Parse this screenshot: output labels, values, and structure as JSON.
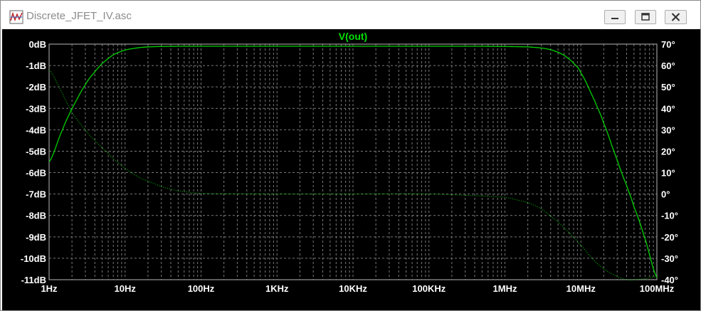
{
  "window": {
    "title": "Discrete_JFET_IV.asc",
    "app_icon": "ltspice-waveform-icon",
    "minimize_icon": "minimize-icon",
    "maximize_icon": "maximize-icon",
    "close_icon": "close-icon"
  },
  "chart_data": {
    "type": "line",
    "title": "V(out)",
    "xlabel": "",
    "ylabel": "",
    "x_scale": "log",
    "xlim": [
      1,
      100000000
    ],
    "x_ticks": [
      1,
      10,
      100,
      1000,
      10000,
      100000,
      1000000,
      10000000,
      100000000
    ],
    "x_tick_labels": [
      "1Hz",
      "10Hz",
      "100Hz",
      "1KHz",
      "10KHz",
      "100KHz",
      "1MHz",
      "10MHz",
      "100MHz"
    ],
    "ylim_left": [
      -11,
      0
    ],
    "y_left_ticks": [
      0,
      -1,
      -2,
      -3,
      -4,
      -5,
      -6,
      -7,
      -8,
      -9,
      -10,
      -11
    ],
    "y_left_tick_labels": [
      "0dB",
      "-1dB",
      "-2dB",
      "-3dB",
      "-4dB",
      "-5dB",
      "-6dB",
      "-7dB",
      "-8dB",
      "-9dB",
      "-10dB",
      "-11dB"
    ],
    "ylim_right": [
      -40,
      70
    ],
    "y_right_ticks": [
      70,
      60,
      50,
      40,
      30,
      20,
      10,
      0,
      -10,
      -20,
      -30,
      -40
    ],
    "y_right_tick_labels": [
      "70°",
      "60°",
      "50°",
      "40°",
      "30°",
      "20°",
      "10°",
      "0°",
      "-10°",
      "-20°",
      "-30°",
      "-40°"
    ],
    "grid": true,
    "colors": {
      "background": "#000000",
      "trace": "#00d000",
      "title": "#00e000",
      "grid": "#7a7a7a",
      "axis": "#9a9a9a",
      "tick_label": "#ffffff"
    },
    "series": [
      {
        "axis": "left",
        "style": "solid",
        "x": [
          1,
          1.5,
          2,
          3,
          4,
          5,
          7,
          10,
          15,
          20,
          30,
          50,
          100,
          1000,
          10000,
          100000,
          500000,
          1000000,
          2000000,
          3000000,
          4000000,
          5000000,
          6000000,
          7000000,
          8000000,
          10000000,
          15000000,
          20000000,
          30000000,
          40000000,
          50000000,
          70000000,
          100000000
        ],
        "values": [
          -5.5,
          -4.0,
          -3.0,
          -1.9,
          -1.3,
          -0.9,
          -0.5,
          -0.28,
          -0.17,
          -0.13,
          -0.11,
          -0.1,
          -0.1,
          -0.1,
          -0.1,
          -0.1,
          -0.1,
          -0.11,
          -0.13,
          -0.18,
          -0.26,
          -0.38,
          -0.52,
          -0.7,
          -0.9,
          -1.35,
          -2.6,
          -3.7,
          -5.4,
          -6.6,
          -7.6,
          -9.1,
          -10.9
        ]
      },
      {
        "axis": "right",
        "style": "dotted",
        "x": [
          1,
          1.5,
          2,
          3,
          4,
          5,
          7,
          10,
          15,
          20,
          30,
          50,
          100,
          1000,
          10000,
          100000,
          1000000,
          2000000,
          3000000,
          5000000,
          7000000,
          10000000,
          15000000,
          20000000,
          30000000,
          40000000,
          50000000,
          70000000,
          100000000
        ],
        "values": [
          58,
          47,
          38,
          30,
          25,
          21.5,
          16.5,
          12,
          8,
          6,
          3.5,
          1.5,
          0.3,
          0,
          0,
          0,
          -1.5,
          -4,
          -7,
          -13,
          -18,
          -24,
          -31,
          -35,
          -38.5,
          -40,
          -40,
          -39.5,
          -38.5
        ]
      }
    ]
  }
}
